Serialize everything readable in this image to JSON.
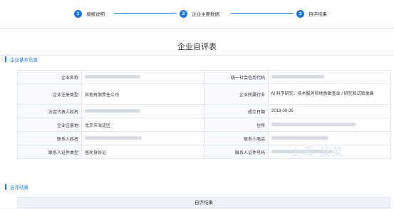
{
  "steps": [
    {
      "num": "1",
      "label": "填报说明"
    },
    {
      "num": "2",
      "label": "企业主要数据"
    },
    {
      "num": "3",
      "label": "自评结果"
    }
  ],
  "page_title": "企业自评表",
  "basic_section": {
    "title": "企业基本信息"
  },
  "rows": [
    {
      "k1": "企业名称",
      "v1": "",
      "k2": "统一社会信用代码",
      "v2": ""
    },
    {
      "k1": "企业注册类型",
      "v1": "其他有限责任公司",
      "k2": "企业所属行业",
      "v2": "M 科学研究、技术服务和地质勘查业 / 研究和试验发展"
    },
    {
      "k1": "法定代表人姓名",
      "v1": "",
      "k2": "成立日期",
      "v2": "2018-09-25"
    },
    {
      "k1": "企业注册地",
      "v1": "北京市海淀区",
      "k2": "住所",
      "v2": ""
    },
    {
      "k1": "联系人姓名",
      "v1": "",
      "k2": "联系人电话",
      "v2": ""
    },
    {
      "k1": "联系人证件类型",
      "v1": "居民身份证",
      "k2": "联系人证件号码",
      "v2": ""
    }
  ],
  "result_section": {
    "title": "自评结果",
    "bar_title": "自评结果"
  },
  "colors": {
    "accent": "#1f78e0"
  }
}
